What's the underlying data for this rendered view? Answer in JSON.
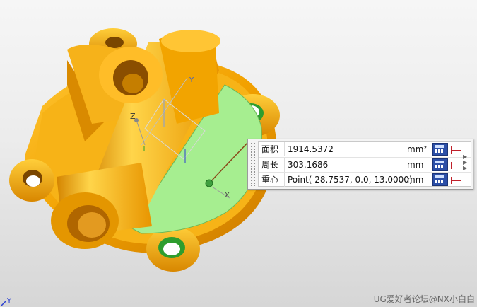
{
  "viewport": {
    "axis_label_y": "Y",
    "axis_label_z": "Z",
    "axis_label_x": "X",
    "corner_axis_label": "Y"
  },
  "measure_panel": {
    "rows": [
      {
        "label": "面积",
        "value": "1914.5372",
        "unit": "mm²"
      },
      {
        "label": "周长",
        "value": "303.1686",
        "unit": "mm"
      },
      {
        "label": "重心",
        "value": "Point( 28.7537, 0.0, 13.0000)",
        "unit": "mm"
      }
    ],
    "icons": [
      "calculator-icon",
      "dimension-icon"
    ]
  },
  "watermark": "UG爱好者论坛@NX小白白"
}
